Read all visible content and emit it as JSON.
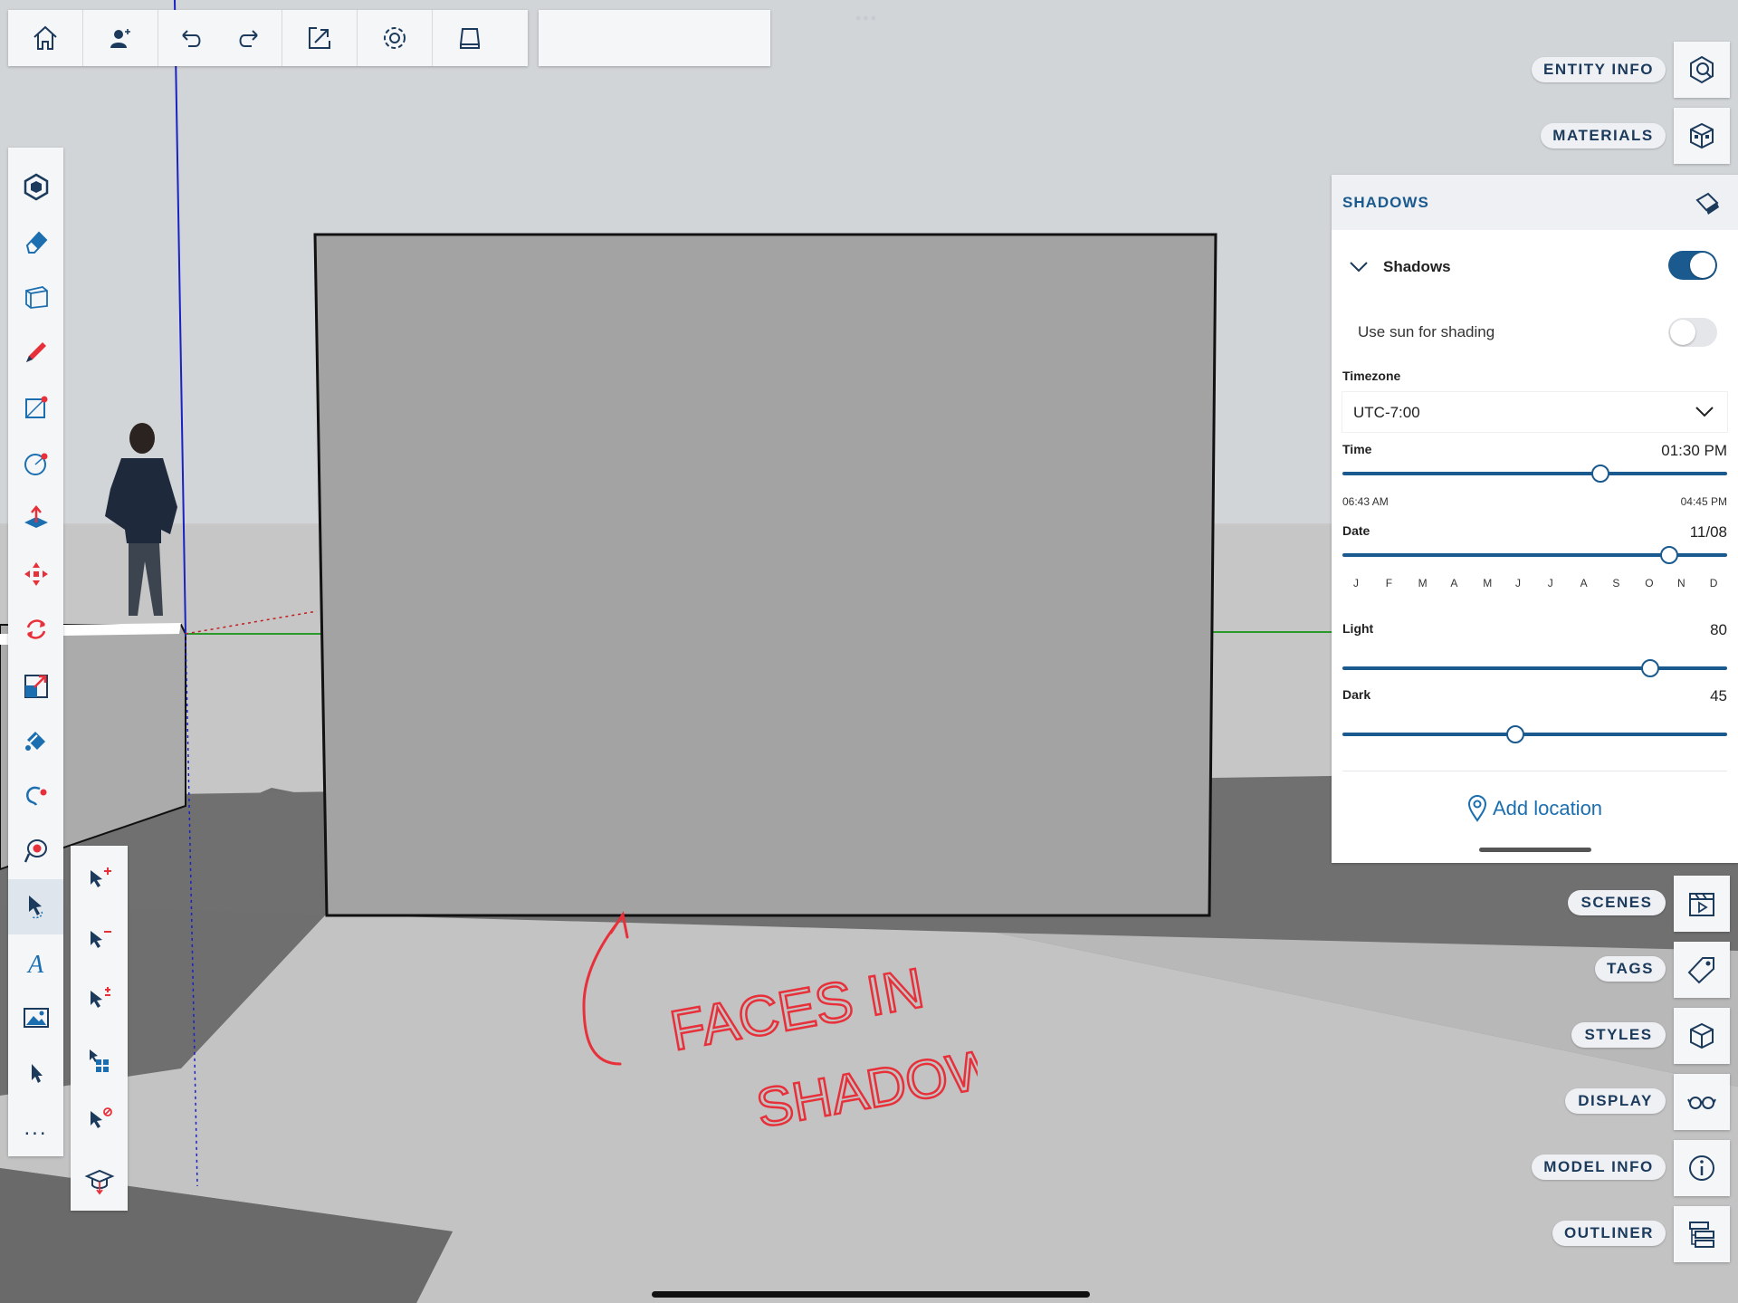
{
  "toolbar": {
    "items": [
      "home-icon",
      "add-person-icon",
      "undo-icon",
      "redo-icon",
      "export-icon",
      "settings-icon",
      "tray-icon"
    ],
    "search_value": ""
  },
  "left_tools": [
    "component-icon",
    "eraser-icon",
    "box-select-icon",
    "pencil-icon",
    "rectangle-icon",
    "circle-icon",
    "push-pull-icon",
    "move-icon",
    "rotate-icon",
    "scale-icon",
    "paint-bucket-icon",
    "lasso-icon",
    "orbit-icon",
    "select-icon",
    "text-icon",
    "image-icon",
    "pointer-icon",
    "more-icon"
  ],
  "left_more_label": "...",
  "sub_tools": [
    "select-add-icon",
    "select-subtract-icon",
    "select-toggle-icon",
    "select-all-icon",
    "select-none-icon",
    "tutorial-icon"
  ],
  "right_panel": {
    "entity_info": "ENTITY INFO",
    "materials": "MATERIALS",
    "scenes": "SCENES",
    "tags": "TAGS",
    "styles": "STYLES",
    "display": "DISPLAY",
    "model_info": "MODEL INFO",
    "outliner": "OUTLINER"
  },
  "shadows": {
    "header": "SHADOWS",
    "section_title": "Shadows",
    "shadows_on": true,
    "use_sun_label": "Use sun for shading",
    "use_sun_on": false,
    "timezone_label": "Timezone",
    "timezone_value": "UTC-7:00",
    "time_label": "Time",
    "time_value": "01:30 PM",
    "time_start": "06:43 AM",
    "time_end": "04:45 PM",
    "time_fraction": 0.67,
    "date_label": "Date",
    "date_value": "11/08",
    "date_fraction": 0.85,
    "months": [
      "J",
      "F",
      "M",
      "A",
      "M",
      "J",
      "J",
      "A",
      "S",
      "O",
      "N",
      "D"
    ],
    "light_label": "Light",
    "light_value": "80",
    "dark_label": "Dark",
    "dark_value": "45",
    "add_location": "Add location"
  },
  "annotation": {
    "line1": "FACES IN",
    "line2": "SHADOW",
    "color": "#e8303a"
  },
  "colors": {
    "accent": "#1b5a8e",
    "label_text": "#1b3a5c"
  }
}
